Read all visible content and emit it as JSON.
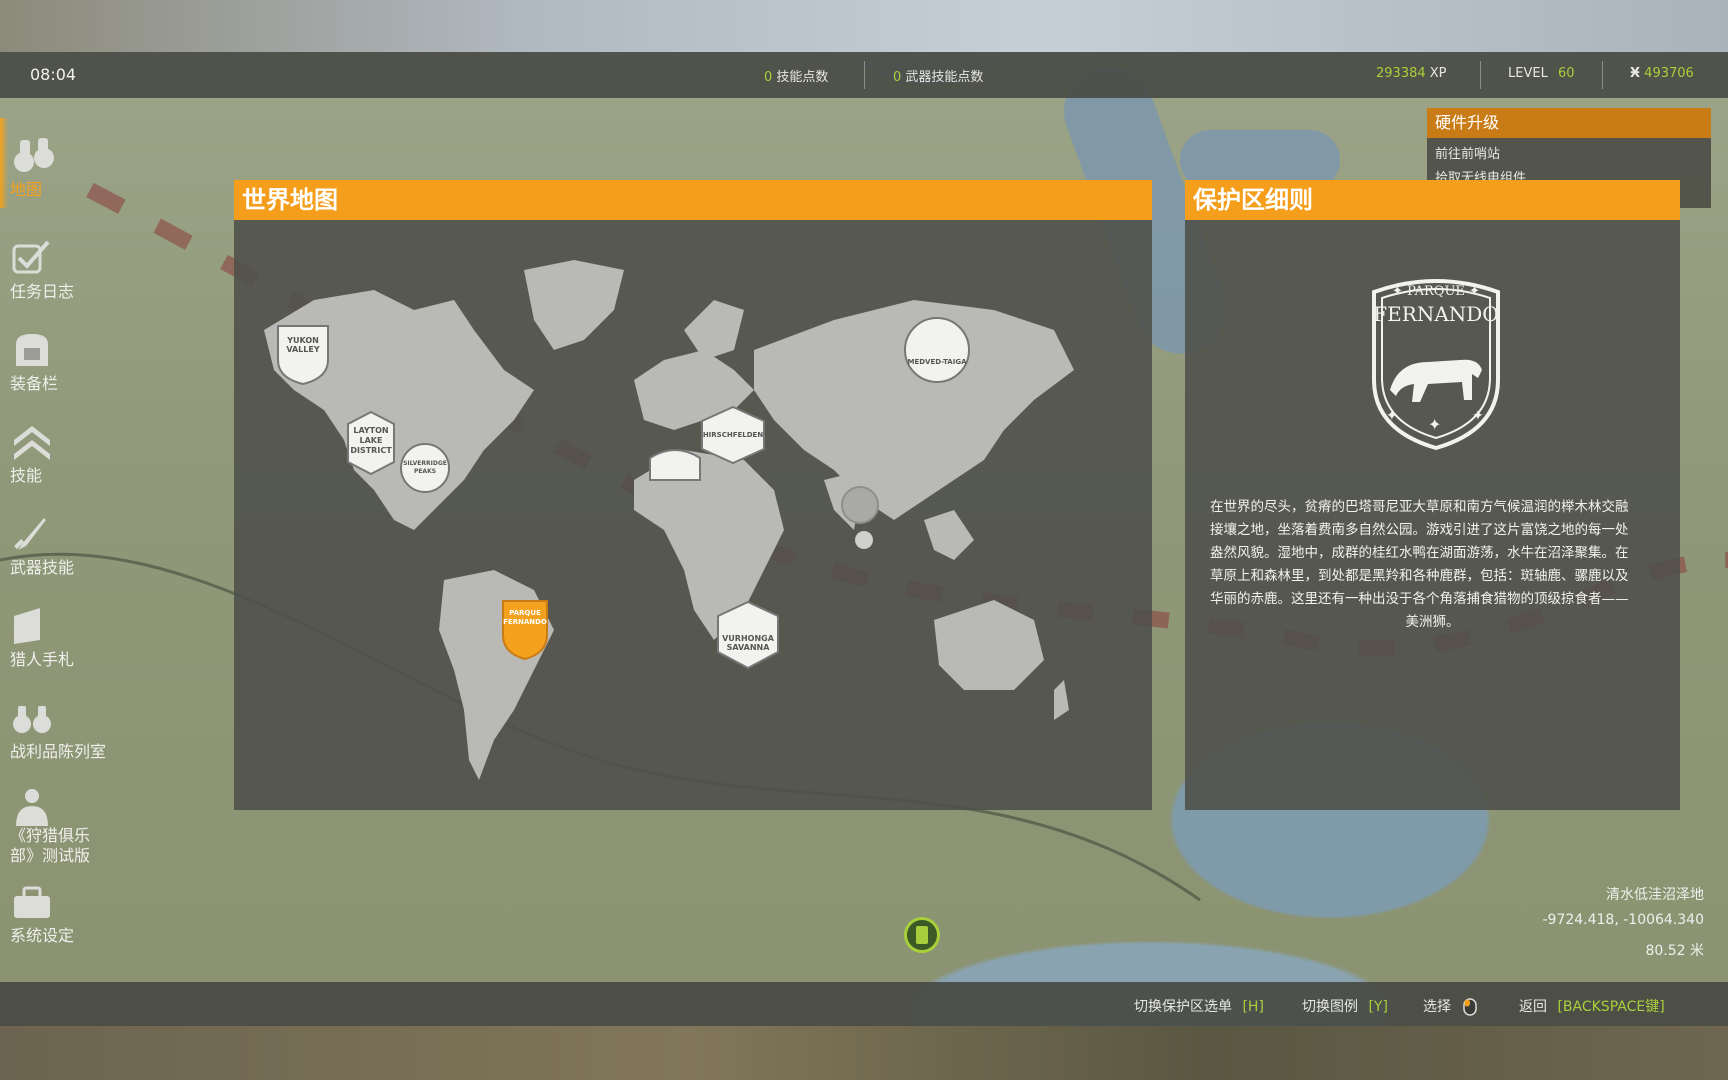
{
  "hud": {
    "time": "08:04",
    "skill_points_value": "0",
    "skill_points_label": "技能点数",
    "weapon_skill_points_value": "0",
    "weapon_skill_points_label": "武器技能点数",
    "xp_value": "293384",
    "xp_label": "XP",
    "level_label": "LEVEL",
    "level_value": "60",
    "currency_symbol": "Ӿ",
    "currency_value": "493706"
  },
  "sidebar": {
    "items": [
      {
        "label": "地图",
        "icon": "binoculars-icon"
      },
      {
        "label": "任务日志",
        "icon": "checkbox-icon"
      },
      {
        "label": "装备栏",
        "icon": "backpack-icon"
      },
      {
        "label": "技能",
        "icon": "chevrons-up-icon"
      },
      {
        "label": "武器技能",
        "icon": "knife-icon"
      },
      {
        "label": "猎人手札",
        "icon": "notebook-icon"
      },
      {
        "label": "战利品陈列室",
        "icon": "trophy-binoculars-icon"
      },
      {
        "label": "《狩猎俱乐部》测试版",
        "icon": "hunter-icon"
      },
      {
        "label": "系统设定",
        "icon": "toolbox-icon"
      }
    ]
  },
  "quest": {
    "title": "硬件升级",
    "lines": [
      "前往前哨站",
      "拾取无线电组件"
    ]
  },
  "world_map": {
    "title": "世界地图",
    "reserves": [
      {
        "line1": "YUKON",
        "line2": "VALLEY"
      },
      {
        "line1": "LAYTON",
        "line2": "LAKE",
        "line3": "DISTRICT"
      },
      {
        "line1": "SILVERRIDGE",
        "line2": "PEAKS"
      },
      {
        "line1": "PARQUE",
        "line2": "FERNANDO"
      },
      {
        "line1": "HIRSCHFELDEN"
      },
      {
        "line1": "MEDVED-TAIGA"
      },
      {
        "line1": "VURHONGA",
        "line2": "SAVANNA"
      }
    ]
  },
  "reserve_detail": {
    "title": "保护区细则",
    "badge_top": "PARQUE",
    "badge_name": "FERNANDO",
    "desc_lines": [
      "在世界的尽头，贫瘠的巴塔哥尼亚大草原和南方气候温润的榉木林交融",
      "接壤之地，坐落着费南多自然公园。游戏引进了这片富饶之地的每一处",
      "盎然风貌。湿地中，成群的桂红水鸭在湖面游荡，水牛在沼泽聚集。在",
      "草原上和森林里，到处都是黑羚和各种鹿群，包括：斑轴鹿、骡鹿以及",
      "华丽的赤鹿。这里还有一种出没于各个角落捕食猎物的顶级掠食者——",
      "美洲狮。"
    ]
  },
  "location": {
    "name": "清水低洼沼泽地",
    "coords": "-9724.418, -10064.340",
    "altitude": "80.52 米"
  },
  "controls": [
    {
      "label": "切换保护区选单",
      "key": "[H]"
    },
    {
      "label": "切换图例",
      "key": "[Y]"
    },
    {
      "label": "选择",
      "key": ""
    },
    {
      "label": "返回",
      "key": "[BACKSPACE键]"
    }
  ],
  "colors": {
    "accent": "#f49e1b",
    "highlight_green": "#a8cf3b",
    "selected_reserve": "#f4a11d"
  }
}
